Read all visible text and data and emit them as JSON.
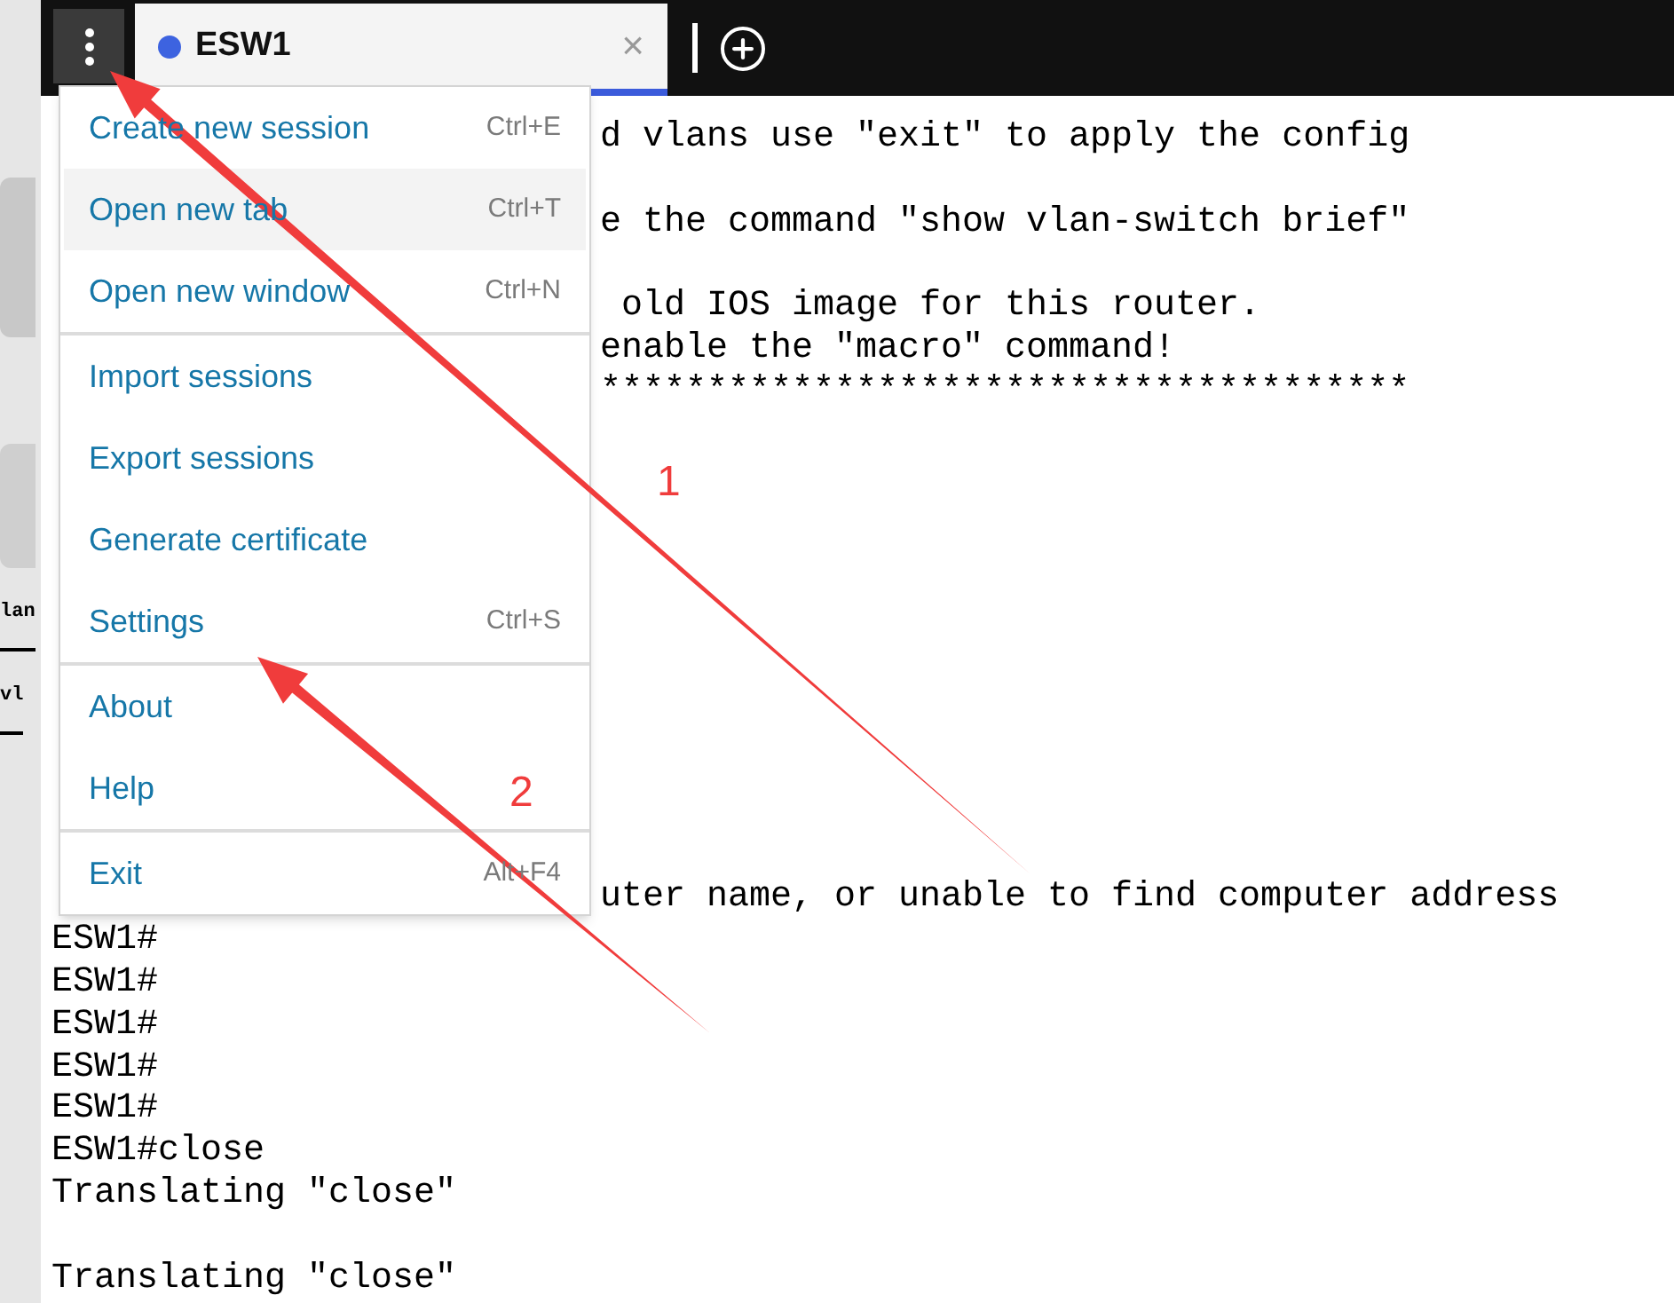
{
  "background_window": {
    "labels": [
      "lan",
      "vl"
    ]
  },
  "tab_bar": {
    "tabs": [
      {
        "title": "ESW1",
        "selected": true,
        "close": "×"
      }
    ]
  },
  "menu": {
    "groups": [
      {
        "items": [
          {
            "label": "Create new session",
            "shortcut": "Ctrl+E",
            "hovered": false
          },
          {
            "label": "Open new tab",
            "shortcut": "Ctrl+T",
            "hovered": true
          },
          {
            "label": "Open new window",
            "shortcut": "Ctrl+N",
            "hovered": false
          }
        ]
      },
      {
        "items": [
          {
            "label": "Import sessions",
            "hovered": false
          },
          {
            "label": "Export sessions",
            "hovered": false
          },
          {
            "label": "Generate certificate",
            "hovered": false
          },
          {
            "label": "Settings",
            "shortcut": "Ctrl+S",
            "hovered": false
          }
        ]
      },
      {
        "items": [
          {
            "label": "About",
            "hovered": false
          },
          {
            "label": "Help",
            "hovered": false
          }
        ]
      },
      {
        "items": [
          {
            "label": "Exit",
            "shortcut": "Alt+F4",
            "hovered": false
          }
        ]
      }
    ]
  },
  "terminal": {
    "lines": [
      {
        "kind": "partial",
        "text": "d vlans use ″exit″ to apply the config"
      },
      {
        "kind": "blank"
      },
      {
        "kind": "partial",
        "text": "e the command ″show vlan-switch brief″"
      },
      {
        "kind": "blank"
      },
      {
        "kind": "partial",
        "text": " old IOS image for this router."
      },
      {
        "kind": "partial",
        "text": "enable the ″macro″ command!"
      },
      {
        "kind": "partial",
        "text": "**************************************"
      },
      {
        "kind": "blank"
      },
      {
        "kind": "blank"
      },
      {
        "kind": "blank"
      },
      {
        "kind": "blank"
      },
      {
        "kind": "blank"
      },
      {
        "kind": "blank"
      },
      {
        "kind": "blank"
      },
      {
        "kind": "blank"
      },
      {
        "kind": "blank"
      },
      {
        "kind": "blank"
      },
      {
        "kind": "blank"
      },
      {
        "kind": "partial",
        "text": "uter name, or unable to find computer address"
      },
      {
        "kind": "full",
        "text": "ESW1#"
      },
      {
        "kind": "full",
        "text": "ESW1#"
      },
      {
        "kind": "full",
        "text": "ESW1#"
      },
      {
        "kind": "full",
        "text": "ESW1#"
      },
      {
        "kind": "full",
        "text": "ESW1#"
      },
      {
        "kind": "full",
        "text": "ESW1#close"
      },
      {
        "kind": "full",
        "text": "Translating ″close″"
      },
      {
        "kind": "blank"
      },
      {
        "kind": "full",
        "text": "Translating ″close″"
      }
    ]
  },
  "annotations": [
    {
      "label": "1"
    },
    {
      "label": "2"
    }
  ]
}
